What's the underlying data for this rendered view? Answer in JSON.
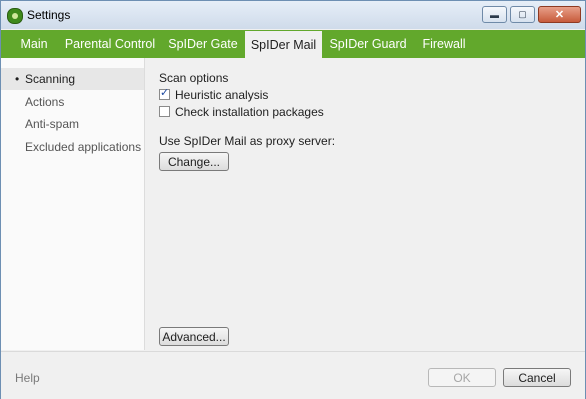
{
  "window": {
    "title": "Settings"
  },
  "window_controls": {
    "minimize": "▬",
    "maximize": "▢",
    "close": "✕"
  },
  "tabs": [
    {
      "label": "Main",
      "active": false
    },
    {
      "label": "Parental Control",
      "active": false
    },
    {
      "label": "SpIDer Gate",
      "active": false
    },
    {
      "label": "SpIDer Mail",
      "active": true
    },
    {
      "label": "SpIDer Guard",
      "active": false
    },
    {
      "label": "Firewall",
      "active": false
    }
  ],
  "sidebar": {
    "bullet": "•",
    "items": [
      {
        "label": "Scanning",
        "active": true
      },
      {
        "label": "Actions",
        "active": false
      },
      {
        "label": "Anti-spam",
        "active": false
      },
      {
        "label": "Excluded applications",
        "active": false
      }
    ]
  },
  "scanning": {
    "section_title": "Scan options",
    "options": [
      {
        "label": "Heuristic analysis",
        "checked": true,
        "mark": "✓"
      },
      {
        "label": "Check installation packages",
        "checked": false,
        "mark": ""
      }
    ],
    "proxy_label": "Use SpIDer Mail as proxy server:",
    "change_button": "Change...",
    "advanced_button": "Advanced..."
  },
  "footer": {
    "help": "Help",
    "ok": "OK",
    "cancel": "Cancel"
  },
  "colors": {
    "tab_bar": "#62a82c",
    "window_border": "#6d8fb3"
  }
}
